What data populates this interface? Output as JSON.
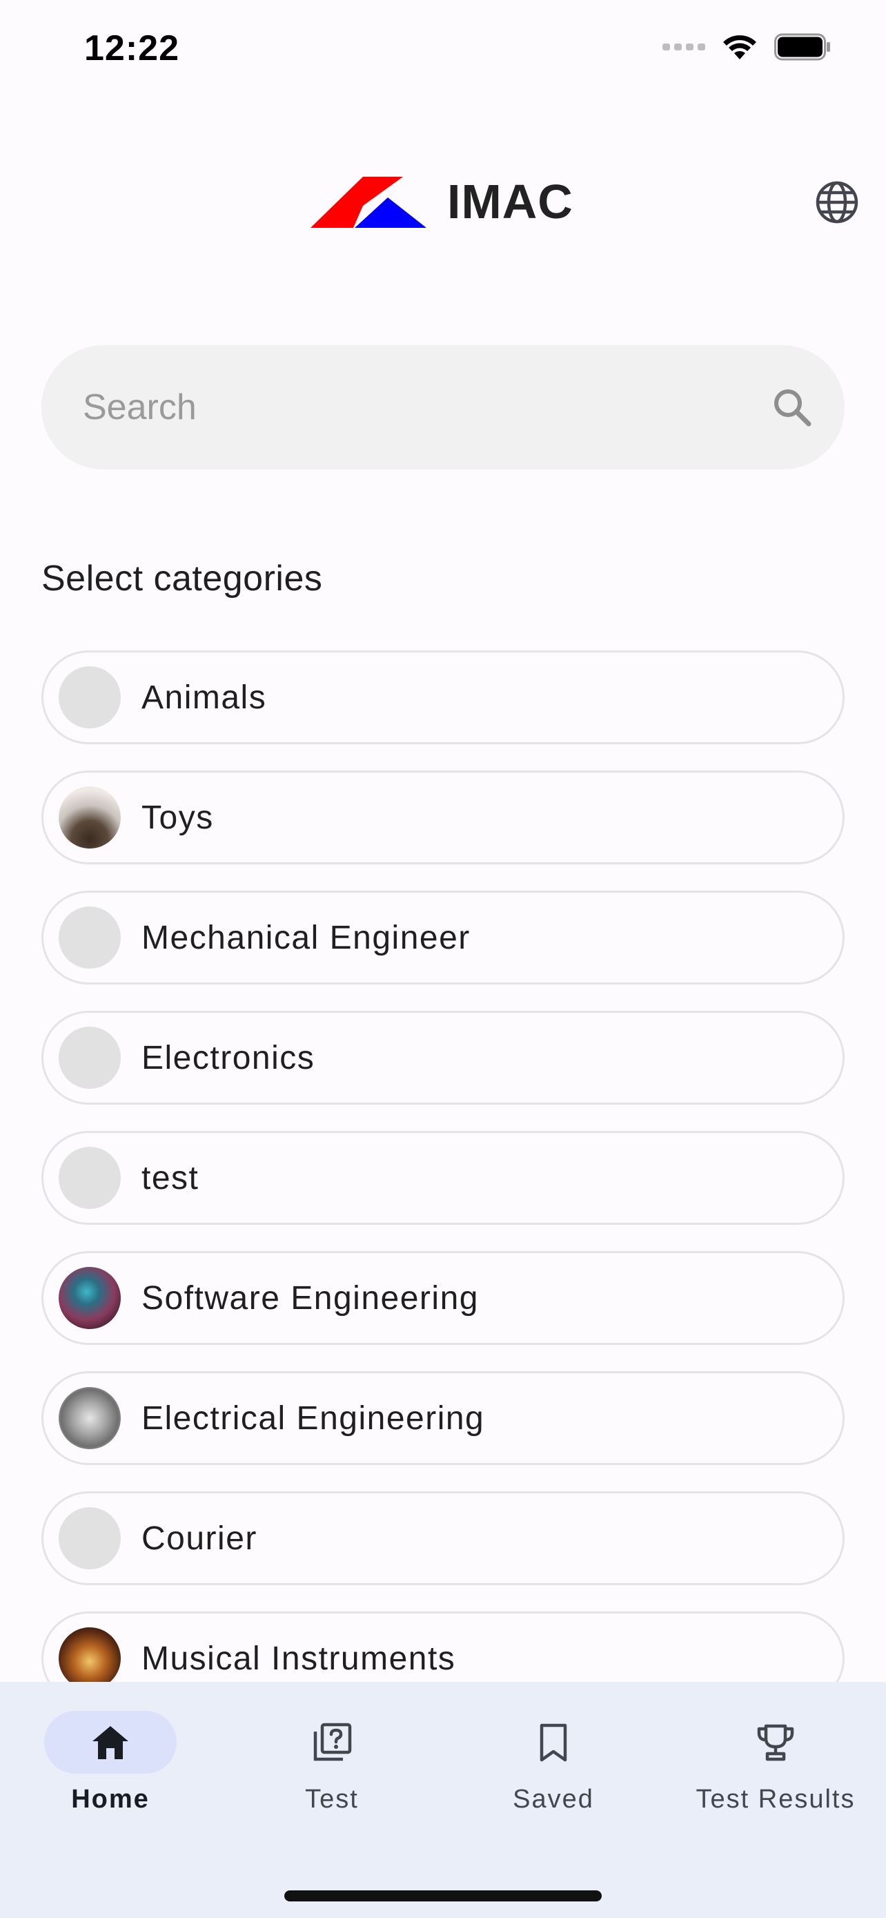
{
  "status_bar": {
    "time": "12:22"
  },
  "header": {
    "logo_text": "IMAC",
    "brand_colors": {
      "red": "#ff0000",
      "blue": "#0000ff"
    }
  },
  "search": {
    "placeholder": "Search",
    "value": ""
  },
  "categories": {
    "title": "Select categories",
    "items": [
      {
        "label": "Animals",
        "has_image": false
      },
      {
        "label": "Toys",
        "has_image": true
      },
      {
        "label": "Mechanical Engineer",
        "has_image": false
      },
      {
        "label": "Electronics",
        "has_image": false
      },
      {
        "label": "test",
        "has_image": false
      },
      {
        "label": "Software Engineering",
        "has_image": true
      },
      {
        "label": "Electrical Engineering",
        "has_image": true
      },
      {
        "label": "Courier",
        "has_image": false
      },
      {
        "label": "Musical Instruments",
        "has_image": true
      }
    ]
  },
  "bottom_nav": {
    "items": [
      {
        "label": "Home",
        "icon": "home-icon",
        "active": true
      },
      {
        "label": "Test",
        "icon": "quiz-icon",
        "active": false
      },
      {
        "label": "Saved",
        "icon": "bookmark-icon",
        "active": false
      },
      {
        "label": "Test Results",
        "icon": "trophy-icon",
        "active": false
      }
    ]
  }
}
